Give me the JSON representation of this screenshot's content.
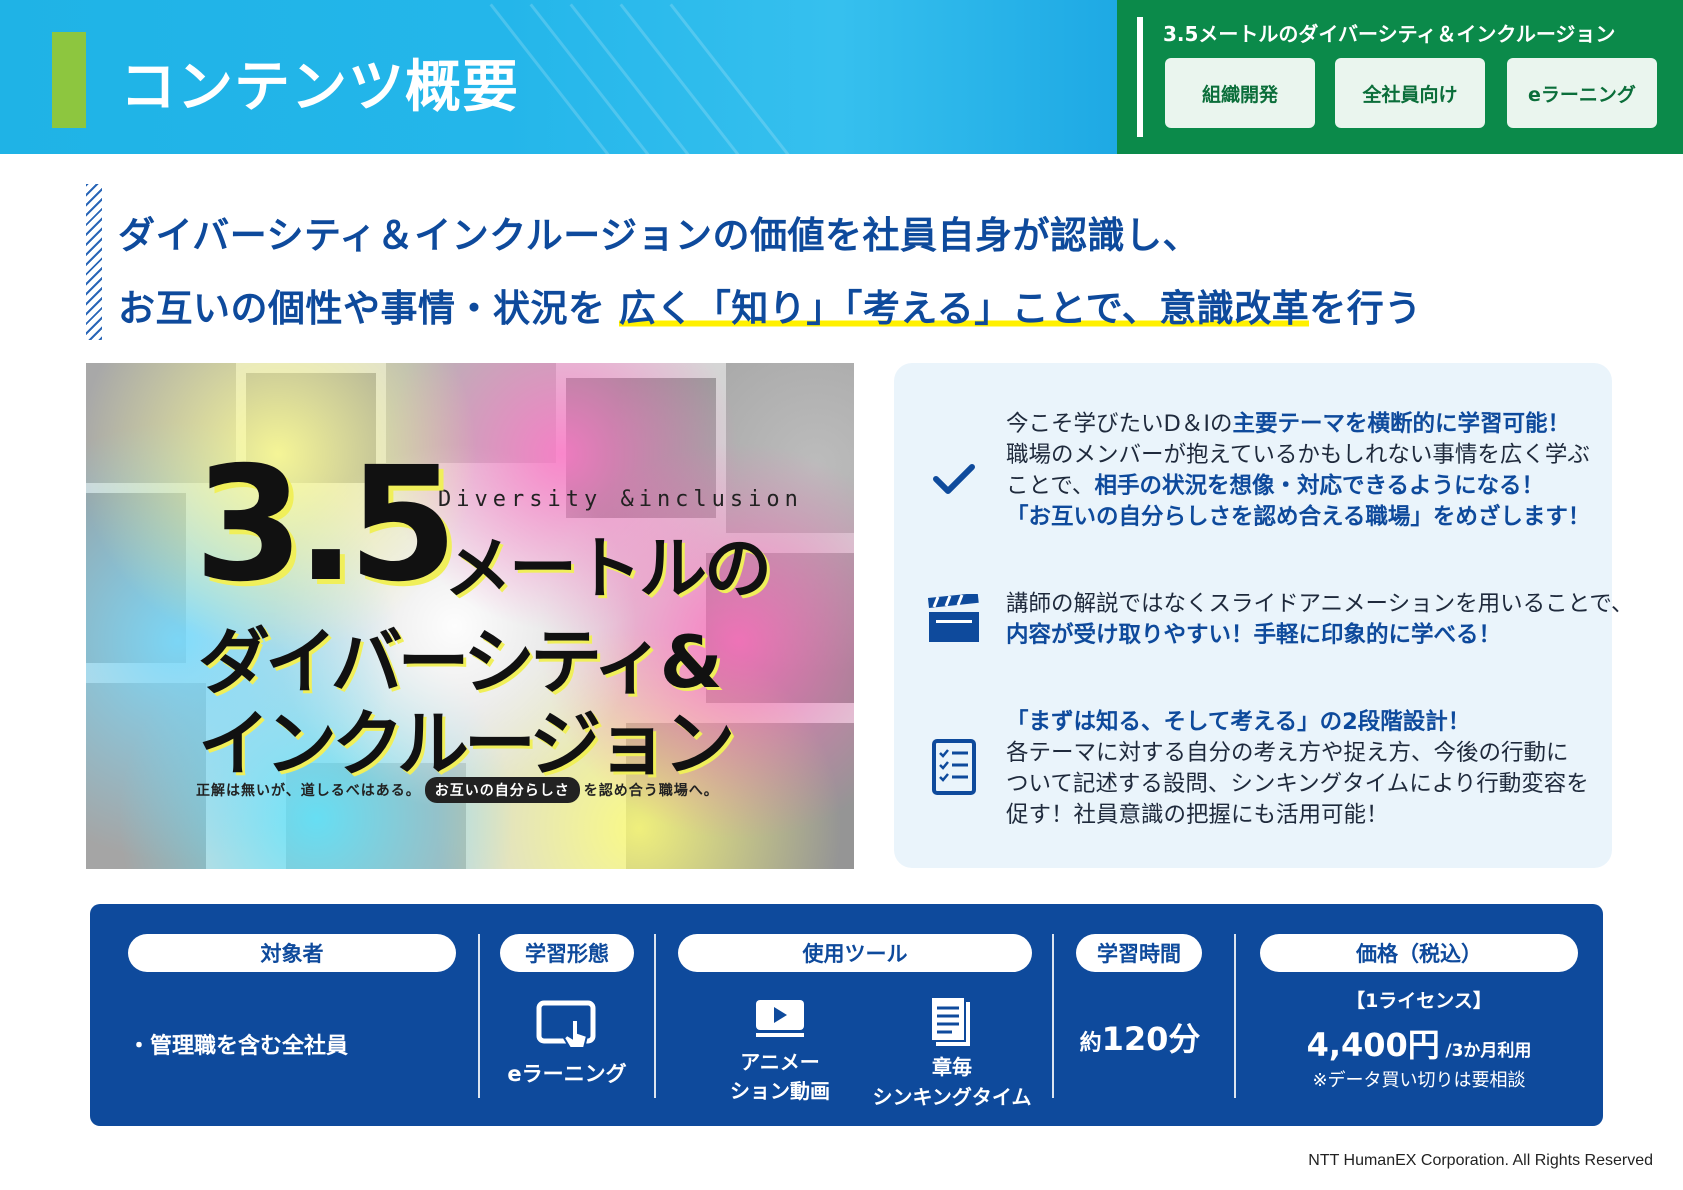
{
  "header": {
    "page_title": "コンテンツ概要",
    "panel_title": "3.5メートルのダイバーシティ＆インクルージョン",
    "tags": [
      "組織開発",
      "全社員向け",
      "eラーニング"
    ]
  },
  "headline": {
    "line1": "ダイバーシティ＆インクルージョンの価値を社員自身が認識し、",
    "line2_a": "お互いの個性や事情・状況を",
    "line2_b": "広く「知り」「考える」ことで、",
    "line2_c": "意識改革",
    "line2_d": "を行う"
  },
  "visual": {
    "subtitle": "Diversity &inclusion",
    "number": "3.5",
    "title_1": "メートルの",
    "title_2": "ダイバーシティ&",
    "title_3": "インクルージョン",
    "tagline_a": "正解は無いが、道しるべはある。",
    "tagline_pill": "お互いの自分らしさ",
    "tagline_b": "を認め合う職場へ。"
  },
  "features": [
    {
      "icon": "check-icon",
      "line1_a": "今こそ学びたいD＆Iの",
      "line1_b": "主要テーマを横断的に学習可能！",
      "line2": "職場のメンバーが抱えているかもしれない事情を広く学ぶ",
      "line3_a": "ことで、",
      "line3_b": "相手の状況を想像・対応できるようになる！",
      "line4": "「お互いの自分らしさを認め合える職場」をめざします！"
    },
    {
      "icon": "clapperboard-icon",
      "line1": "講師の解説ではなくスライドアニメーションを用いることで、",
      "line2": "内容が受け取りやすい！手軽に印象的に学べる！"
    },
    {
      "icon": "checklist-icon",
      "line1": "「まずは知る、そして考える」の2段階設計！",
      "line2": "各テーマに対する自分の考え方や捉え方、今後の行動に",
      "line3": "ついて記述する設問、シンキングタイムにより行動変容を",
      "line4": "促す！社員意識の把握にも活用可能！"
    }
  ],
  "info": {
    "target": {
      "label": "対象者",
      "value": "・管理職を含む全社員"
    },
    "format": {
      "label": "学習形態",
      "icon": "tablet-touch-icon",
      "value": "eラーニング"
    },
    "tools": {
      "label": "使用ツール",
      "items": [
        {
          "icon": "video-icon",
          "line1": "アニメー",
          "line2": "ション動画"
        },
        {
          "icon": "worksheet-icon",
          "line1": "章毎",
          "line2": "シンキングタイム"
        }
      ]
    },
    "time": {
      "label": "学習時間",
      "prefix": "約",
      "value": "120分"
    },
    "price": {
      "label": "価格（税込）",
      "license": "【1ライセンス】",
      "amount": "4,400円",
      "period": "/3か月利用",
      "note": "※データ買い切りは要相談"
    }
  },
  "footer": "NTT HumanEX Corporation. All Rights Reserved",
  "colors": {
    "navy": "#0e4a9c",
    "green": "#0b8a4a",
    "sky": "#24b6ea",
    "lime": "#8dc63f",
    "highlight": "#fff000"
  }
}
